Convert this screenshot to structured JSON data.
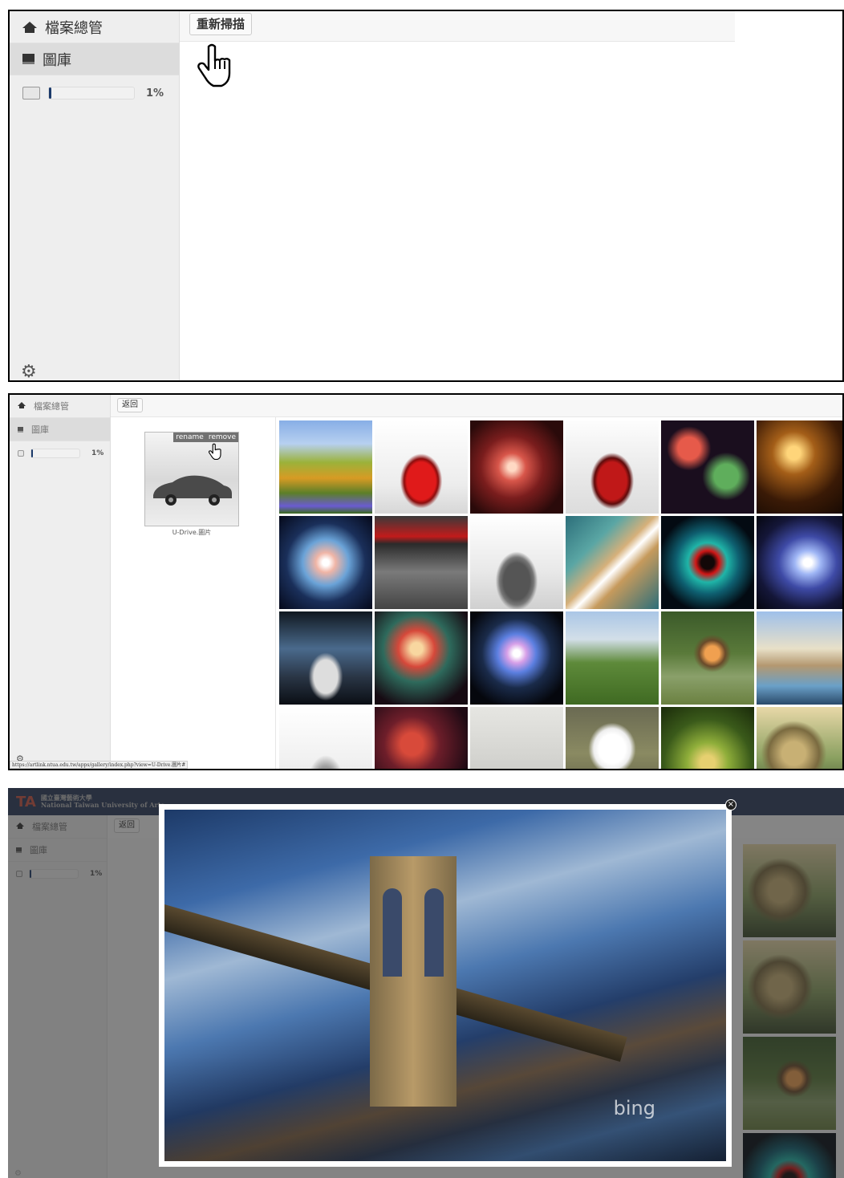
{
  "nav": {
    "file_manager": "檔案總管",
    "gallery": "圖庫"
  },
  "quota": {
    "percent_label": "1%",
    "fill_fraction": 0.01
  },
  "toolbar": {
    "rescan": "重新掃描",
    "back": "返回"
  },
  "folder": {
    "rename": "rename",
    "remove": "remove",
    "caption": "U-Drive.圖片"
  },
  "statusbar": {
    "url": "https://artlink.ntua.edu.tw/apps/gallery/index.php?view=U-Drive.圖片#"
  },
  "viewer": {
    "watermark": "bing",
    "close": "×"
  },
  "icons": {
    "home": "home-icon",
    "gallery": "image-icon",
    "disk": "disk-icon",
    "settings": "gear-icon",
    "pointer": "hand-pointer-icon"
  },
  "colors": {
    "accent": "#1b3a6b"
  }
}
